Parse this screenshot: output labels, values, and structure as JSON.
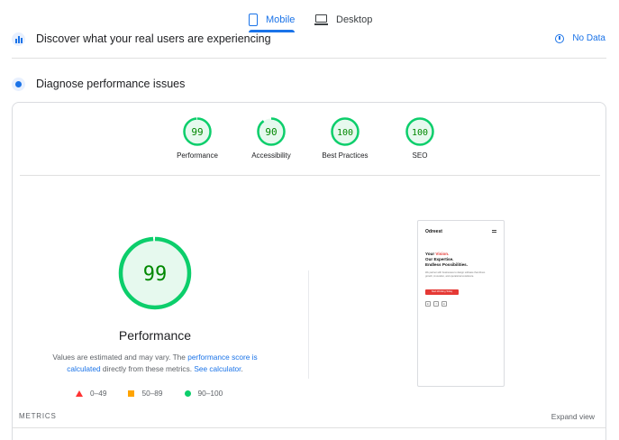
{
  "tabs": {
    "mobile_label": "Mobile",
    "desktop_label": "Desktop",
    "active": "Mobile"
  },
  "field_section": {
    "title": "Discover what your real users are experiencing",
    "status_label": "No Data"
  },
  "lab_section": {
    "title": "Diagnose performance issues"
  },
  "categories": [
    {
      "label": "Performance",
      "score": "99",
      "value": 0.99
    },
    {
      "label": "Accessibility",
      "score": "90",
      "value": 0.9
    },
    {
      "label": "Best Practices",
      "score": "100",
      "value": 1.0
    },
    {
      "label": "SEO",
      "score": "100",
      "value": 1.0
    }
  ],
  "performance": {
    "score": "99",
    "value": 0.99,
    "title": "Performance",
    "desc_prefix": "Values are estimated and may vary. The ",
    "link_score": "performance score is calculated",
    "desc_mid": " directly from these metrics. ",
    "link_calc": "See calculator",
    "desc_suffix": "."
  },
  "legend": {
    "fail": "0–49",
    "average": "50–89",
    "pass": "90–100"
  },
  "metrics": {
    "heading": "METRICS",
    "expand_label": "Expand view"
  },
  "screenshot": {
    "logo": "Odreest",
    "headline_prefix": "Your ",
    "headline_highlight": "Vision.",
    "headline_line2": "Our Expertise.",
    "headline_line3": "Endless Possibilities.",
    "subtext": "We partner with businesses to design software that drives growth, innovation, and operational excellence.",
    "cta": "Start Working Today",
    "social": [
      "in",
      "f",
      "in"
    ]
  },
  "colors": {
    "accent": "#1a73e8",
    "pass": "#0cce6b",
    "pass_text": "#008800",
    "pass_bg": "#e6f9ee",
    "average": "#ffa400",
    "fail": "#ff3333"
  },
  "icons": {
    "mobile": "phone-icon",
    "desktop": "laptop-icon",
    "field": "crux-chart-icon",
    "lab": "lab-data-icon",
    "no_data": "info-icon"
  }
}
